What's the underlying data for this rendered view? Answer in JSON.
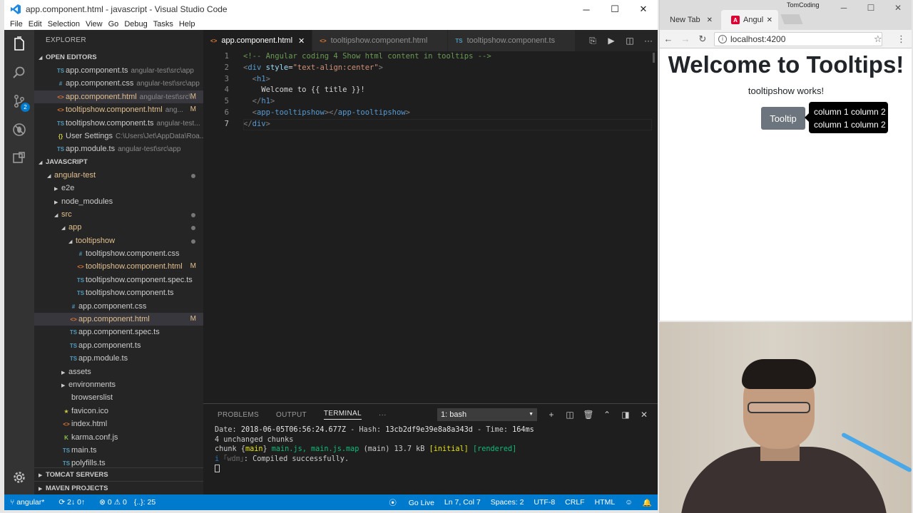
{
  "vscode": {
    "title": "app.component.html - javascript - Visual Studio Code",
    "menu": [
      "File",
      "Edit",
      "Selection",
      "View",
      "Go",
      "Debug",
      "Tasks",
      "Help"
    ],
    "explorer_title": "EXPLORER",
    "scm_badge": "2",
    "open_editors_title": "OPEN EDITORS",
    "open_editors": [
      {
        "icon": "TS",
        "name": "app.component.ts",
        "path": "angular-test\\src\\app",
        "mod": ""
      },
      {
        "icon": "#",
        "name": "app.component.css",
        "path": "angular-test\\src\\app",
        "mod": ""
      },
      {
        "icon": "<>",
        "name": "app.component.html",
        "path": "angular-test\\src\\...",
        "mod": "M"
      },
      {
        "icon": "<>",
        "name": "tooltipshow.component.html",
        "path": "ang...",
        "mod": "M"
      },
      {
        "icon": "TS",
        "name": "tooltipshow.component.ts",
        "path": "angular-test...",
        "mod": ""
      },
      {
        "icon": "{}",
        "name": "User Settings",
        "path": "C:\\Users\\Jet\\AppData\\Roa...",
        "mod": ""
      },
      {
        "icon": "TS",
        "name": "app.module.ts",
        "path": "angular-test\\src\\app",
        "mod": ""
      }
    ],
    "project_title": "JAVASCRIPT",
    "tree": [
      {
        "name": "angular-test",
        "depth": 1,
        "type": "folder-open"
      },
      {
        "name": "e2e",
        "depth": 2,
        "type": "folder"
      },
      {
        "name": "node_modules",
        "depth": 2,
        "type": "folder"
      },
      {
        "name": "src",
        "depth": 2,
        "type": "folder-open"
      },
      {
        "name": "app",
        "depth": 3,
        "type": "folder-open"
      },
      {
        "name": "tooltipshow",
        "depth": 4,
        "type": "folder-open"
      },
      {
        "name": "tooltipshow.component.css",
        "depth": 5,
        "icon": "#"
      },
      {
        "name": "tooltipshow.component.html",
        "depth": 5,
        "icon": "<>",
        "mod": "M"
      },
      {
        "name": "tooltipshow.component.spec.ts",
        "depth": 5,
        "icon": "TS"
      },
      {
        "name": "tooltipshow.component.ts",
        "depth": 5,
        "icon": "TS"
      },
      {
        "name": "app.component.css",
        "depth": 4,
        "icon": "#"
      },
      {
        "name": "app.component.html",
        "depth": 4,
        "icon": "<>",
        "mod": "M"
      },
      {
        "name": "app.component.spec.ts",
        "depth": 4,
        "icon": "TS"
      },
      {
        "name": "app.component.ts",
        "depth": 4,
        "icon": "TS"
      },
      {
        "name": "app.module.ts",
        "depth": 4,
        "icon": "TS"
      },
      {
        "name": "assets",
        "depth": 3,
        "type": "folder"
      },
      {
        "name": "environments",
        "depth": 3,
        "type": "folder"
      },
      {
        "name": "browserslist",
        "depth": 3,
        "icon": ""
      },
      {
        "name": "favicon.ico",
        "depth": 3,
        "icon": "★"
      },
      {
        "name": "index.html",
        "depth": 3,
        "icon": "<>"
      },
      {
        "name": "karma.conf.js",
        "depth": 3,
        "icon": "K"
      },
      {
        "name": "main.ts",
        "depth": 3,
        "icon": "TS"
      },
      {
        "name": "polyfills.ts",
        "depth": 3,
        "icon": "TS"
      }
    ],
    "tomcat": "TOMCAT SERVERS",
    "maven": "MAVEN PROJECTS",
    "tabs": [
      {
        "label": "app.component.html",
        "icon": "<>",
        "active": true
      },
      {
        "label": "tooltipshow.component.html",
        "icon": "<>",
        "active": false
      },
      {
        "label": "tooltipshow.component.ts",
        "icon": "TS",
        "active": false
      }
    ],
    "code_lines": [
      "<!-- Angular coding 4 Show html content in tooltips -->",
      "<div style=\"text-align:center\">",
      "  <h1>",
      "    Welcome to {{ title }}!",
      "  </h1>",
      "  <app-tooltipshow></app-tooltipshow>",
      "</div>"
    ],
    "panel_tabs": [
      "PROBLEMS",
      "OUTPUT",
      "TERMINAL"
    ],
    "terminal_select": "1: bash",
    "terminal": {
      "date": "2018-06-05T06:56:24.677Z",
      "hash": "13cb2df9e39e8a8a343d",
      "time": "164ms",
      "unchanged": "4 unchanged chunks",
      "chunk_name": "main",
      "chunk_files": "main.js, main.js.map",
      "chunk_main": "(main) 13.7 kB",
      "initial": "[initial]",
      "rendered": "[rendered]",
      "wdm_info": "i",
      "wdm": "｢wdm｣",
      "compiled": ": Compiled successfully."
    },
    "status": {
      "branch": "angular*",
      "sync": "2↓ 0↑",
      "problems": "⊗ 0 ⚠ 0",
      "selection": "{..}: 25",
      "golive": "Go Live",
      "position": "Ln 7, Col 7",
      "spaces": "Spaces: 2",
      "encoding": "UTF-8",
      "eol": "CRLF",
      "lang": "HTML"
    }
  },
  "browser": {
    "tab1": "New Tab",
    "tab2": "Angul",
    "channel": "TomCoding",
    "url": "localhost:4200",
    "heading": "Welcome to Tooltips!",
    "subtext": "tooltipshow works!",
    "button": "Tooltip",
    "tooltip_lines": [
      "column 1 column 2",
      "column 1 column 2"
    ]
  },
  "colors": {
    "accent": "#007acc",
    "editor_bg": "#1e1e1e",
    "sidebar_bg": "#252526",
    "button_bg": "#6c757d"
  }
}
